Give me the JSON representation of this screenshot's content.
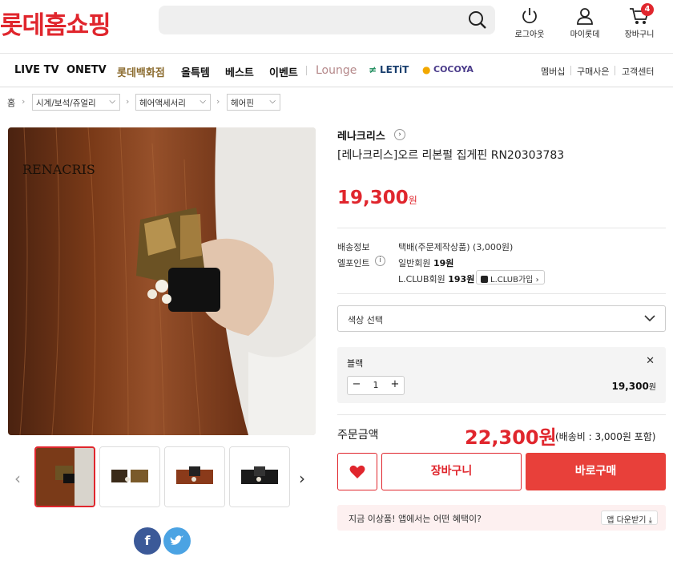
{
  "header": {
    "logo": "롯데홈쇼핑",
    "search_placeholder": "",
    "icons": [
      {
        "label": "로그아웃",
        "icon": "power-icon"
      },
      {
        "label": "마이롯데",
        "icon": "user-icon"
      },
      {
        "label": "장바구니",
        "icon": "cart-icon",
        "badge": "4"
      }
    ]
  },
  "nav": {
    "items": [
      "LIVE TV",
      "ONETV",
      "롯데백화점",
      "올특템",
      "베스트",
      "이벤트",
      "Lounge",
      "LETiT",
      "COCOYA"
    ],
    "right": [
      "멤버십",
      "구매사은",
      "고객센터"
    ],
    "accent_color": "#8b6b2e",
    "brand_color": "#e0262d"
  },
  "breadcrumb": {
    "home": "홈",
    "levels": [
      "시계/보석/쥬얼리",
      "헤어액세서리",
      "헤어핀"
    ]
  },
  "gallery": {
    "watermark": "RENACRIS"
  },
  "product": {
    "brand": "레나크리스",
    "name": "[레나크리스]오르 리본펄 집게핀 RN20303783",
    "price": "19,300",
    "price_unit": "원",
    "shipping_label": "배송정보",
    "shipping_value": "택배(주문제작상품) (3,000원)",
    "points_label": "엘포인트",
    "points_general_label": "일반회원",
    "points_general_value": "19원",
    "points_lclub_label": "L.CLUB회원",
    "points_lclub_value": "193원",
    "lclub_button": "L.CLUB가입"
  },
  "option": {
    "select_placeholder": "색상 선택",
    "selected_name": "블랙",
    "quantity": "1",
    "option_price": "19,300",
    "option_price_unit": "원"
  },
  "order": {
    "total_label": "주문금액",
    "total_price": "22,300원",
    "shipping_note": "(배송비 : 3,000원 포함)",
    "cart_button": "장바구니",
    "buy_button": "바로구매"
  },
  "promo": {
    "text": "지금 이상품! 앱에서는 어떤 혜택이?",
    "button": "앱 다운받기 ⤓"
  }
}
